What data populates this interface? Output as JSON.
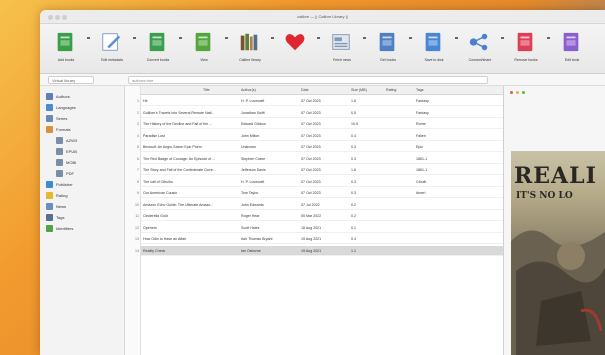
{
  "window": {
    "title": "calibre — || Calibre Library ||"
  },
  "colors": {
    "heart": "#e0262f",
    "addbooks": "#2f9a3c",
    "selected_row": "#d9d9d9"
  },
  "toolbar": [
    {
      "label": "Add books",
      "icon": "add-books-icon",
      "color": "#3a9e46"
    },
    {
      "label": "Edit metadata",
      "icon": "edit-metadata-icon",
      "color": "#5b8fd6"
    },
    {
      "label": "Convert books",
      "icon": "convert-books-icon",
      "color": "#3b9e4c"
    },
    {
      "label": "View",
      "icon": "view-icon",
      "color": "#52a63a"
    },
    {
      "label": "Calibre library",
      "icon": "library-icon",
      "color": "#5d7e3b"
    },
    {
      "label": "",
      "icon": "heart-icon",
      "color": "#e0262f"
    },
    {
      "label": "Fetch news",
      "icon": "fetch-news-icon",
      "color": "#7f99b6"
    },
    {
      "label": "Get books",
      "icon": "get-books-icon",
      "color": "#4f7fc4"
    },
    {
      "label": "Save to disk",
      "icon": "save-to-disk-icon",
      "color": "#4785d6"
    },
    {
      "label": "Connect/share",
      "icon": "connect-share-icon",
      "color": "#4a7fd1"
    },
    {
      "label": "Remove books",
      "icon": "remove-books-icon",
      "color": "#de3f56"
    },
    {
      "label": "Edit book",
      "icon": "edit-book-icon",
      "color": "#8a5fd0"
    }
  ],
  "search": {
    "library_placeholder": "Virtual library",
    "books_value": "authors:true"
  },
  "sidebar": [
    {
      "label": "Authors",
      "icon": "authors-icon",
      "color": "#5f7fb8"
    },
    {
      "label": "Languages",
      "icon": "languages-icon",
      "color": "#4d8ad1"
    },
    {
      "label": "Series",
      "icon": "series-icon",
      "color": "#6c8ab0"
    },
    {
      "label": "Formats",
      "icon": "formats-icon",
      "color": "#d6933a"
    },
    {
      "label": "AZW3",
      "icon": "format-icon",
      "color": "#7a8ea8"
    },
    {
      "label": "EPUB",
      "icon": "format-icon",
      "color": "#7a8ea8"
    },
    {
      "label": "MOBI",
      "icon": "format-icon",
      "color": "#7a8ea8"
    },
    {
      "label": "PDF",
      "icon": "format-icon",
      "color": "#7a8ea8"
    },
    {
      "label": "Publisher",
      "icon": "publisher-icon",
      "color": "#3e8bd3"
    },
    {
      "label": "Rating",
      "icon": "rating-icon",
      "color": "#e6b82e"
    },
    {
      "label": "News",
      "icon": "news-icon",
      "color": "#6a8fba"
    },
    {
      "label": "Tags",
      "icon": "tags-icon",
      "color": "#5a6f8e"
    },
    {
      "label": "Identifiers",
      "icon": "identifiers-icon",
      "color": "#52a246"
    }
  ],
  "table": {
    "columns": [
      "Title",
      "Author(s)",
      "Date",
      "Size (MB)",
      "Rating",
      "Tags"
    ],
    "rows": [
      {
        "n": "1",
        "title": "He",
        "author": "H. P. Lovecraft",
        "date": "07 Oct 2023",
        "size": "1.6",
        "tags": "Fantasy"
      },
      {
        "n": "2",
        "title": "Gulliver's Travels Into Several Remote Nati...",
        "author": "Jonathan Swift",
        "date": "07 Oct 2023",
        "size": "0.5",
        "tags": "Fantasy"
      },
      {
        "n": "3",
        "title": "The History of the Decline and Fall of the ...",
        "author": "Edward Gibbon",
        "date": "07 Oct 2023",
        "size": "10.5",
        "tags": "Rome"
      },
      {
        "n": "4",
        "title": "Paradise Lost",
        "author": "John Milton",
        "date": "07 Oct 2023",
        "size": "0.4",
        "tags": "Fallen"
      },
      {
        "n": "5",
        "title": "Beowulf: An Anglo-Saxon Epic Poem",
        "author": "Unknown",
        "date": "07 Oct 2023",
        "size": "0.3",
        "tags": "Epic"
      },
      {
        "n": "6",
        "title": "The Red Badge of Courage: An Episode of ...",
        "author": "Stephen Crane",
        "date": "07 Oct 2023",
        "size": "0.3",
        "tags": "1861-1"
      },
      {
        "n": "7",
        "title": "The Story and Fall of the Confederate Gove...",
        "author": "Jefferson Davis",
        "date": "07 Oct 2023",
        "size": "1.6",
        "tags": "1861-1"
      },
      {
        "n": "8",
        "title": "The call of Cthulhu",
        "author": "H. P. Lovecraft",
        "date": "07 Oct 2023",
        "size": "0.3",
        "tags": "Cthulh"
      },
      {
        "n": "9",
        "title": "Our American Cousin",
        "author": "Tom Taylor",
        "date": "07 Oct 2023",
        "size": "0.3",
        "tags": "Ameri"
      },
      {
        "n": "10",
        "title": "Amazon Echo Guide: The Ultimate Amazo...",
        "author": "John Edwards",
        "date": "07 Jul 2022",
        "size": "0.2",
        "tags": ""
      },
      {
        "n": "11",
        "title": "Cinderella Gold",
        "author": "Roger Hear",
        "date": "05 Mar 2022",
        "size": "0.2",
        "tags": ""
      },
      {
        "n": "12",
        "title": "Openers",
        "author": "Scott Hales",
        "date": "18 Aug 2021",
        "size": "0.1",
        "tags": ""
      },
      {
        "n": "13",
        "title": "How Odin to Have an Affair",
        "author": "Ash Thomas Bryant",
        "date": "19 Aug 2021",
        "size": "0.4",
        "tags": ""
      },
      {
        "n": "14",
        "title": "Reality Check",
        "author": "Ian Osborne",
        "date": "19 Aug 2021",
        "size": "1.1",
        "tags": ""
      }
    ]
  },
  "detail": {
    "cover_title": "REALI",
    "cover_subtitle": "IT'S NO LO"
  }
}
